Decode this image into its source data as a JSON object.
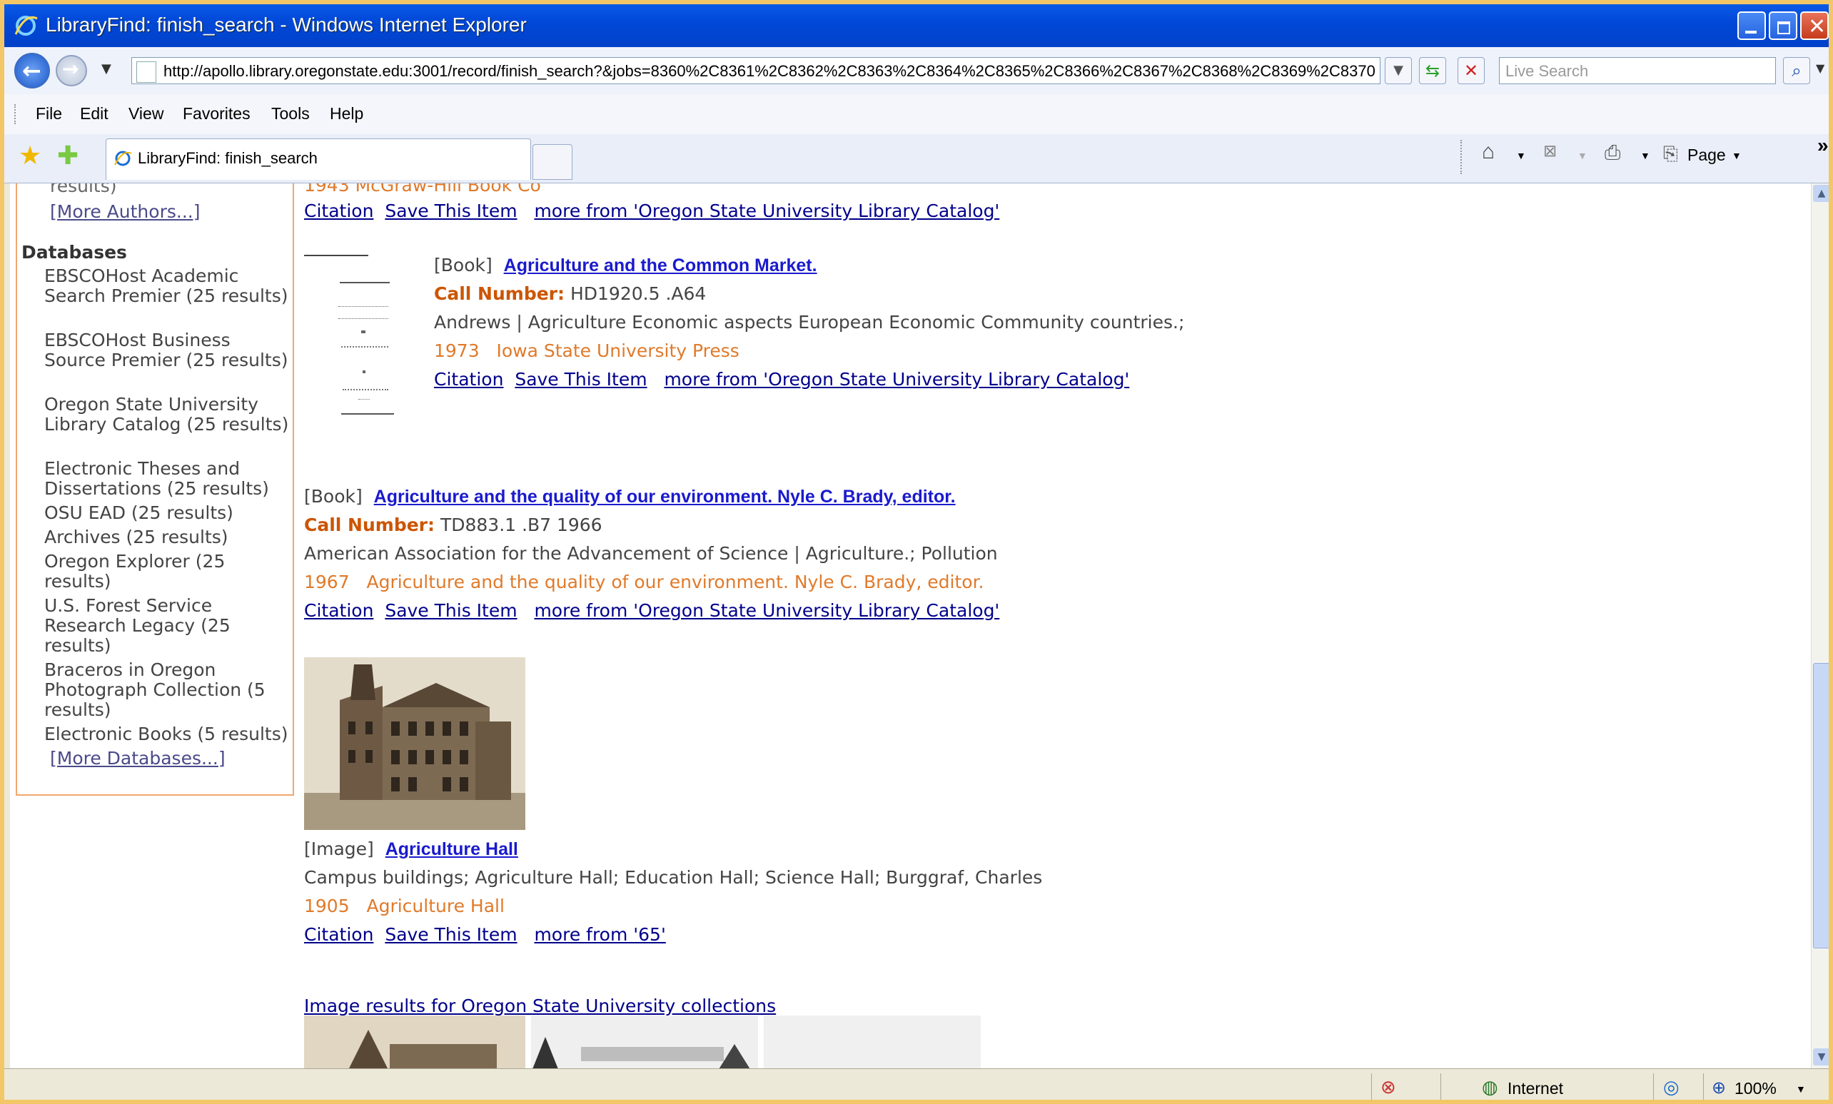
{
  "window": {
    "title": "LibraryFind: finish_search - Windows Internet Explorer"
  },
  "address_bar": {
    "url": "http://apollo.library.oregonstate.edu:3001/record/finish_search?&jobs=8360%2C8361%2C8362%2C8363%2C8364%2C8365%2C8366%2C8367%2C8368%2C8369%2C8370",
    "search_placeholder": "Live Search"
  },
  "menu": [
    "File",
    "Edit",
    "View",
    "Favorites",
    "Tools",
    "Help"
  ],
  "tab": {
    "label": "LibraryFind: finish_search"
  },
  "command_bar": {
    "page_label": "Page",
    "more": "»"
  },
  "sidebar": {
    "author_partial_1": "results)",
    "more_authors": "[More Authors...]",
    "databases_heading": "Databases",
    "databases": [
      "EBSCOHost Academic Search Premier (25 results)",
      "EBSCOHost Business Source Premier (25 results)",
      "Oregon State University Library Catalog (25 results)",
      "Electronic Theses and Dissertations (25 results)",
      "OSU EAD (25 results)",
      "Archives (25 results)",
      "Oregon Explorer (25 results)",
      "U.S. Forest Service Research Legacy (25 results)",
      "Braceros in Oregon Photograph Collection (5 results)",
      "Electronic Books (5 results)"
    ],
    "more_databases": "[More Databases...]"
  },
  "link_labels": {
    "citation": "Citation",
    "save": "Save This Item"
  },
  "records": [
    {
      "partial_top": "1943   McGraw-Hill Book Co",
      "more_from": "more from 'Oregon State University Library Catalog'"
    },
    {
      "type": "[Book]",
      "title": "Agriculture and the Common Market.",
      "call_label": "Call Number:",
      "call_number": "HD1920.5 .A64",
      "subjects": "Andrews | Agriculture Economic aspects European Economic Community countries.;",
      "year": "1973",
      "publisher": "Iowa State University Press",
      "more_from": "more from 'Oregon State University Library Catalog'"
    },
    {
      "type": "[Book]",
      "title": "Agriculture and the quality of our environment. Nyle C. Brady, editor.",
      "call_label": "Call Number:",
      "call_number": "TD883.1 .B7 1966",
      "subjects": "American Association for the Advancement of Science | Agriculture.; Pollution",
      "year": "1967",
      "publisher": "Agriculture and the quality of our environment. Nyle C. Brady, editor.",
      "more_from": "more from 'Oregon State University Library Catalog'"
    },
    {
      "type": "[Image]",
      "title": "Agriculture Hall",
      "subjects": "Campus buildings; Agriculture Hall; Education Hall; Science Hall; Burggraf, Charles",
      "year": "1905",
      "publisher": "Agriculture Hall",
      "more_from": "more from '65'"
    }
  ],
  "image_results_link": "Image results for Oregon State University collections",
  "status_bar": {
    "zone": "Internet",
    "zoom": "100%"
  },
  "colors": {
    "title_bar": "#0148d8",
    "link": "#00008b",
    "orange_text": "#e07a2a",
    "call_number_label": "#cc5500",
    "sidebar_border": "#f0a76c"
  }
}
